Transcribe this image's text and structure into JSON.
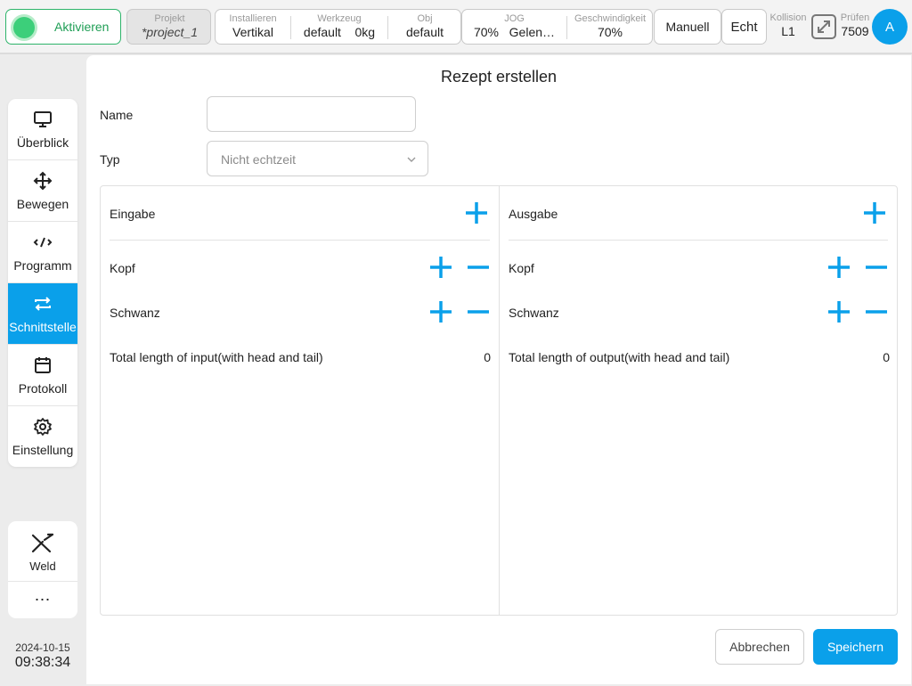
{
  "topbar": {
    "activate_label": "Aktivieren",
    "project": {
      "key": "Projekt",
      "value": "*project_1"
    },
    "install": {
      "key": "Installieren",
      "value": "Vertikal"
    },
    "tool": {
      "key": "Werkzeug",
      "value": "default",
      "extra": "0kg"
    },
    "obj": {
      "key": "Obj",
      "value": "default"
    },
    "jog": {
      "key": "JOG",
      "value": "70%",
      "mode": "Gelen…"
    },
    "speed": {
      "key": "Geschwindigkeit",
      "value": "70%"
    },
    "manual_label": "Manuell",
    "real_label": "Echt",
    "collision": {
      "key": "Kollision",
      "value": "L1"
    },
    "check": {
      "key": "Prüfen",
      "value": "7509"
    },
    "avatar_letter": "A"
  },
  "sidebar": {
    "items": [
      {
        "label": "Überblick",
        "icon": "monitor-icon"
      },
      {
        "label": "Bewegen",
        "icon": "move-arrows-icon"
      },
      {
        "label": "Programm",
        "icon": "code-icon"
      },
      {
        "label": "Schnittstelle",
        "icon": "swap-arrows-icon",
        "active": true
      },
      {
        "label": "Protokoll",
        "icon": "calendar-icon"
      },
      {
        "label": "Einstellung",
        "icon": "gear-icon"
      }
    ],
    "weld_label": "Weld",
    "more_label": "⋯",
    "date": "2024-10-15",
    "time": "09:38:34"
  },
  "form": {
    "title": "Rezept erstellen",
    "name_label": "Name",
    "name_value": "",
    "type_label": "Typ",
    "type_value": "Nicht echtzeit"
  },
  "input_panel": {
    "title": "Eingabe",
    "head_label": "Kopf",
    "tail_label": "Schwanz",
    "total_label": "Total length of input(with head and tail)",
    "total_value": "0"
  },
  "output_panel": {
    "title": "Ausgabe",
    "head_label": "Kopf",
    "tail_label": "Schwanz",
    "total_label": "Total length of output(with head and tail)",
    "total_value": "0"
  },
  "actions": {
    "cancel_label": "Abbrechen",
    "save_label": "Speichern"
  },
  "colors": {
    "accent": "#0aa0ea",
    "active_green": "#3ccf7a"
  }
}
